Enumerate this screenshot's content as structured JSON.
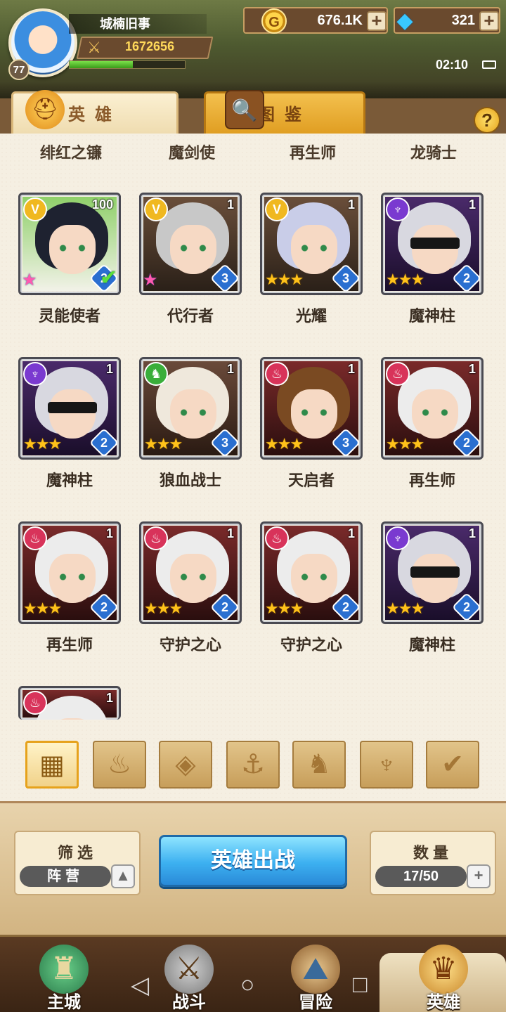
{
  "player": {
    "name": "城楠旧事",
    "level": "77",
    "power": "1672656",
    "xp_fraction": 0.55
  },
  "resources": {
    "gold": "676.1K",
    "gems": "321"
  },
  "status": {
    "time": "02:10"
  },
  "tabs": {
    "hero": "英雄",
    "atlas": "图鉴"
  },
  "partial_row_names": [
    "绯红之镰",
    "魔剑使",
    "再生师",
    "龙骑士"
  ],
  "heroes": [
    {
      "name": "灵能使者",
      "level": "100",
      "faction": "gold",
      "stars": 1,
      "rainbow": true,
      "tier": "2",
      "selected": true
    },
    {
      "name": "代行者",
      "level": "1",
      "faction": "gold",
      "stars": 1,
      "rainbow": true,
      "tier": "3"
    },
    {
      "name": "光耀",
      "level": "1",
      "faction": "gold",
      "stars": 3,
      "tier": "3"
    },
    {
      "name": "魔神柱",
      "level": "1",
      "faction": "purple",
      "stars": 3,
      "tier": "2"
    },
    {
      "name": "魔神柱",
      "level": "1",
      "faction": "purple",
      "stars": 3,
      "tier": "2"
    },
    {
      "name": "狼血战士",
      "level": "1",
      "faction": "green",
      "stars": 3,
      "tier": "3"
    },
    {
      "name": "天启者",
      "level": "1",
      "faction": "red",
      "stars": 3,
      "tier": "3"
    },
    {
      "name": "再生师",
      "level": "1",
      "faction": "red",
      "stars": 3,
      "tier": "2"
    },
    {
      "name": "再生师",
      "level": "1",
      "faction": "red",
      "stars": 3,
      "tier": "2"
    },
    {
      "name": "守护之心",
      "level": "1",
      "faction": "red",
      "stars": 3,
      "tier": "2"
    },
    {
      "name": "守护之心",
      "level": "1",
      "faction": "red",
      "stars": 3,
      "tier": "2"
    },
    {
      "name": "魔神柱",
      "level": "1",
      "faction": "purple",
      "stars": 3,
      "tier": "2"
    },
    {
      "name": "",
      "level": "1",
      "faction": "red",
      "stars": 0,
      "tier": ""
    }
  ],
  "faction_filters": [
    "all-grid-icon",
    "flame-icon",
    "diamond-icon",
    "anchor-icon",
    "wolf-icon",
    "demon-icon",
    "crest-icon"
  ],
  "controls": {
    "filter_title": "筛选",
    "filter_value": "阵营",
    "deploy": "英雄出战",
    "count_title": "数量",
    "count_value": "17/50"
  },
  "nav": {
    "main_city": "主城",
    "battle": "战斗",
    "adventure": "冒险",
    "hero": "英雄"
  },
  "colors": {
    "gold_faction": "#f0b820",
    "purple_faction": "#7a3ad0",
    "green_faction": "#3aae3a",
    "red_faction": "#d8335a",
    "deploy_button": "#3cb0f0"
  }
}
